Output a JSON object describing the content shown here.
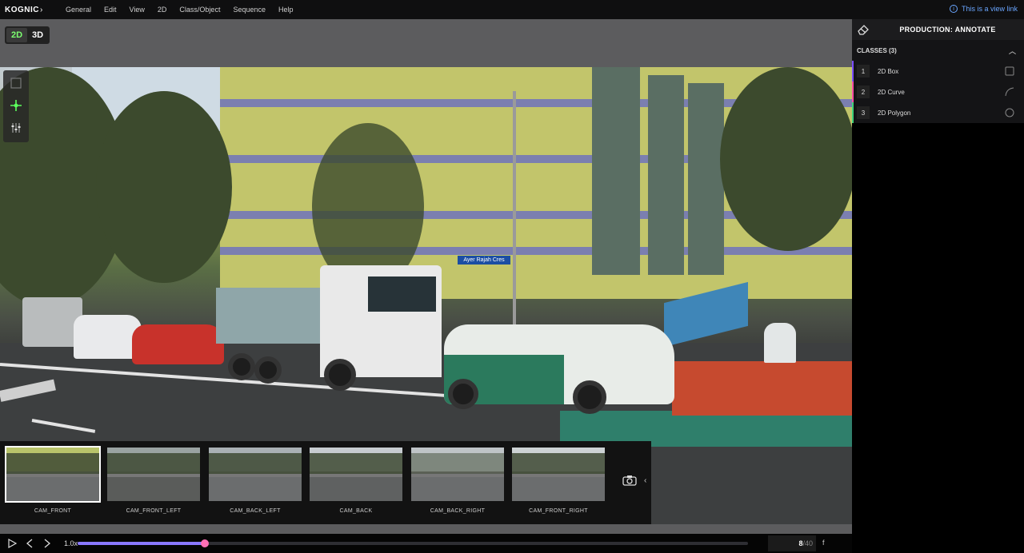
{
  "menubar": {
    "logo": "KOGNIC",
    "items": [
      "General",
      "Edit",
      "View",
      "2D",
      "Class/Object",
      "Sequence",
      "Help"
    ],
    "view_link": "This is a view link"
  },
  "mode_toggle": {
    "two_d": "2D",
    "three_d": "3D",
    "active": "2D"
  },
  "scene": {
    "street_sign": "Ayer Rajah Cres"
  },
  "thumbnails": [
    {
      "label": "CAM_FRONT",
      "selected": true
    },
    {
      "label": "CAM_FRONT_LEFT",
      "selected": false
    },
    {
      "label": "CAM_BACK_LEFT",
      "selected": false
    },
    {
      "label": "CAM_BACK",
      "selected": false
    },
    {
      "label": "CAM_BACK_RIGHT",
      "selected": false
    },
    {
      "label": "CAM_FRONT_RIGHT",
      "selected": false
    }
  ],
  "timeline": {
    "speed": "1.0x",
    "current_frame": "8",
    "total_frames": "/40",
    "progress": 0.19,
    "hotkey": "f"
  },
  "panel": {
    "title": "PRODUCTION: ANNOTATE",
    "classes_header": "CLASSES (3)",
    "classes": [
      {
        "num": "1",
        "name": "2D Box",
        "color": "#7b4dff",
        "shape": "box-icon"
      },
      {
        "num": "2",
        "name": "2D Curve",
        "color": "#ff4fa3",
        "shape": "curve-icon"
      },
      {
        "num": "3",
        "name": "2D Polygon",
        "color": "#3fd27a",
        "shape": "polygon-icon"
      }
    ]
  },
  "colors": {
    "accent_green": "#7cff70",
    "progress": "#8a78ff",
    "playhead": "#ff6fb5",
    "link": "#6aa6ff"
  }
}
